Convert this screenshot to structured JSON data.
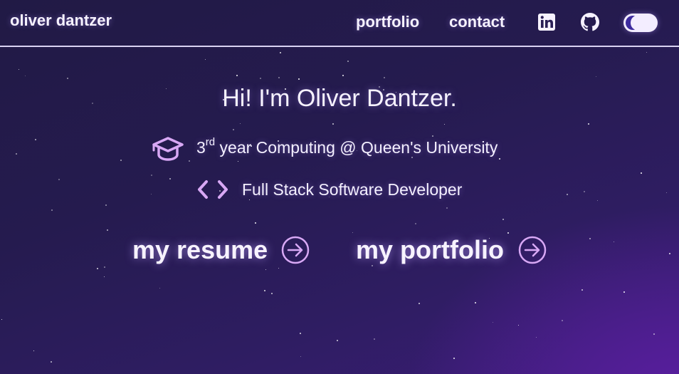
{
  "header": {
    "brand": "oliver dantzer",
    "nav": {
      "portfolio": "portfolio",
      "contact": "contact"
    },
    "icons": {
      "linkedin": "linkedin-icon",
      "github": "github-icon",
      "theme_toggle": "theme-toggle"
    }
  },
  "hero": {
    "greeting": "Hi! I'm Oliver Dantzer.",
    "education": {
      "year": "3",
      "suffix": "rd",
      "rest": " year Computing @ Queen's University",
      "icon": "graduation-cap-icon"
    },
    "role": {
      "text": "Full Stack Software Developer",
      "icon": "code-brackets-icon"
    },
    "buttons": {
      "resume": "my resume",
      "portfolio": "my portfolio",
      "icon": "arrow-right-circle-icon"
    }
  },
  "colors": {
    "background_top": "#211a45",
    "background_glow": "#5a1fa0",
    "accent_icon": "#d8a8f5",
    "text": "#f6f2ff"
  }
}
